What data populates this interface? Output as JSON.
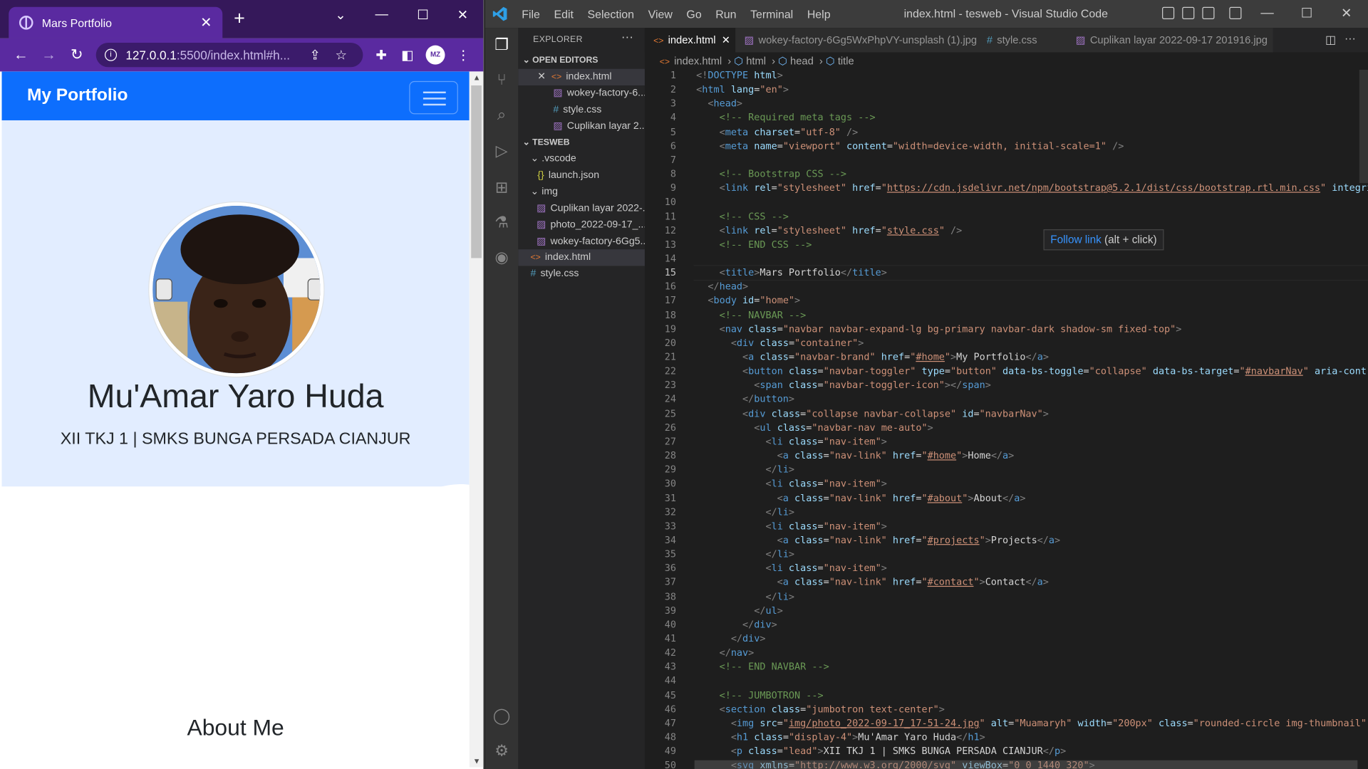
{
  "browser": {
    "tab_title": "Mars Portfolio",
    "url_host": "127.0.0.1",
    "url_rest": ":5500/index.html#h..."
  },
  "page": {
    "brand": "My Portfolio",
    "name": "Mu'Amar Yaro Huda",
    "lead": "XII TKJ 1 | SMKS BUNGA PERSADA CIANJUR",
    "about_heading": "About Me",
    "photo_alt": "Muamaryh"
  },
  "vscode": {
    "menu": [
      "File",
      "Edit",
      "Selection",
      "View",
      "Go",
      "Run",
      "Terminal",
      "Help"
    ],
    "window_title": "index.html - tesweb - Visual Studio Code",
    "explorer_title": "EXPLORER",
    "open_editors_title": "OPEN EDITORS",
    "open_editors": [
      "index.html",
      "wokey-factory-6...",
      "style.css",
      "Cuplikan layar 2..."
    ],
    "workspace_title": "TESWEB",
    "tree": [
      ".vscode",
      "launch.json",
      "img",
      "Cuplikan layar 2022-...",
      "photo_2022-09-17_...",
      "wokey-factory-6Gg5...",
      "index.html",
      "style.css"
    ],
    "tabs": [
      "index.html",
      "wokey-factory-6Gg5WxPhpVY-unsplash (1).jpg",
      "style.css",
      "Cuplikan layar 2022-09-17 201916.jpg"
    ],
    "breadcrumb": [
      "index.html",
      "html",
      "head",
      "title"
    ],
    "tooltip_link": "Follow link",
    "tooltip_hint": " (alt + click)",
    "active_line": 15,
    "code": [
      "<!DOCTYPE html>",
      "<html lang=\"en\">",
      "  <head>",
      "    <!-- Required meta tags -->",
      "    <meta charset=\"utf-8\" />",
      "    <meta name=\"viewport\" content=\"width=device-width, initial-scale=1\" />",
      "",
      "    <!-- Bootstrap CSS -->",
      "    <link rel=\"stylesheet\" href=\"https://cdn.jsdelivr.net/npm/bootstrap@5.2.1/dist/css/bootstrap.rtl.min.css\" integrit",
      "",
      "    <!-- CSS -->",
      "    <link rel=\"stylesheet\" href=\"style.css\" />",
      "    <!-- END CSS -->",
      "",
      "    <title>Mars Portfolio</title>",
      "  </head>",
      "  <body id=\"home\">",
      "    <!-- NAVBAR -->",
      "    <nav class=\"navbar navbar-expand-lg bg-primary navbar-dark shadow-sm fixed-top\">",
      "      <div class=\"container\">",
      "        <a class=\"navbar-brand\" href=\"#home\">My Portfolio</a>",
      "        <button class=\"navbar-toggler\" type=\"button\" data-bs-toggle=\"collapse\" data-bs-target=\"#navbarNav\" aria-contro",
      "          <span class=\"navbar-toggler-icon\"></span>",
      "        </button>",
      "        <div class=\"collapse navbar-collapse\" id=\"navbarNav\">",
      "          <ul class=\"navbar-nav me-auto\">",
      "            <li class=\"nav-item\">",
      "              <a class=\"nav-link\" href=\"#home\">Home</a>",
      "            </li>",
      "            <li class=\"nav-item\">",
      "              <a class=\"nav-link\" href=\"#about\">About</a>",
      "            </li>",
      "            <li class=\"nav-item\">",
      "              <a class=\"nav-link\" href=\"#projects\">Projects</a>",
      "            </li>",
      "            <li class=\"nav-item\">",
      "              <a class=\"nav-link\" href=\"#contact\">Contact</a>",
      "            </li>",
      "          </ul>",
      "        </div>",
      "      </div>",
      "    </nav>",
      "    <!-- END NAVBAR -->",
      "",
      "    <!-- JUMBOTRON -->",
      "    <section class=\"jumbotron text-center\">",
      "      <img src=\"img/photo_2022-09-17_17-51-24.jpg\" alt=\"Muamaryh\" width=\"200px\" class=\"rounded-circle img-thumbnail\" /",
      "      <h1 class=\"display-4\">Mu'Amar Yaro Huda</h1>",
      "      <p class=\"lead\">XII TKJ 1 | SMKS BUNGA PERSADA CIANJUR</p>",
      "      <svg xmlns=\"http://www.w3.org/2000/svg\" viewBox=\"0 0 1440 320\">"
    ],
    "colors": {
      "activity_bar": "#333333",
      "sidebar": "#252526",
      "editor": "#1e1e1e",
      "tag": "#569cd6",
      "attr": "#9cdcfe",
      "string": "#ce9178",
      "comment": "#6a9955"
    }
  }
}
